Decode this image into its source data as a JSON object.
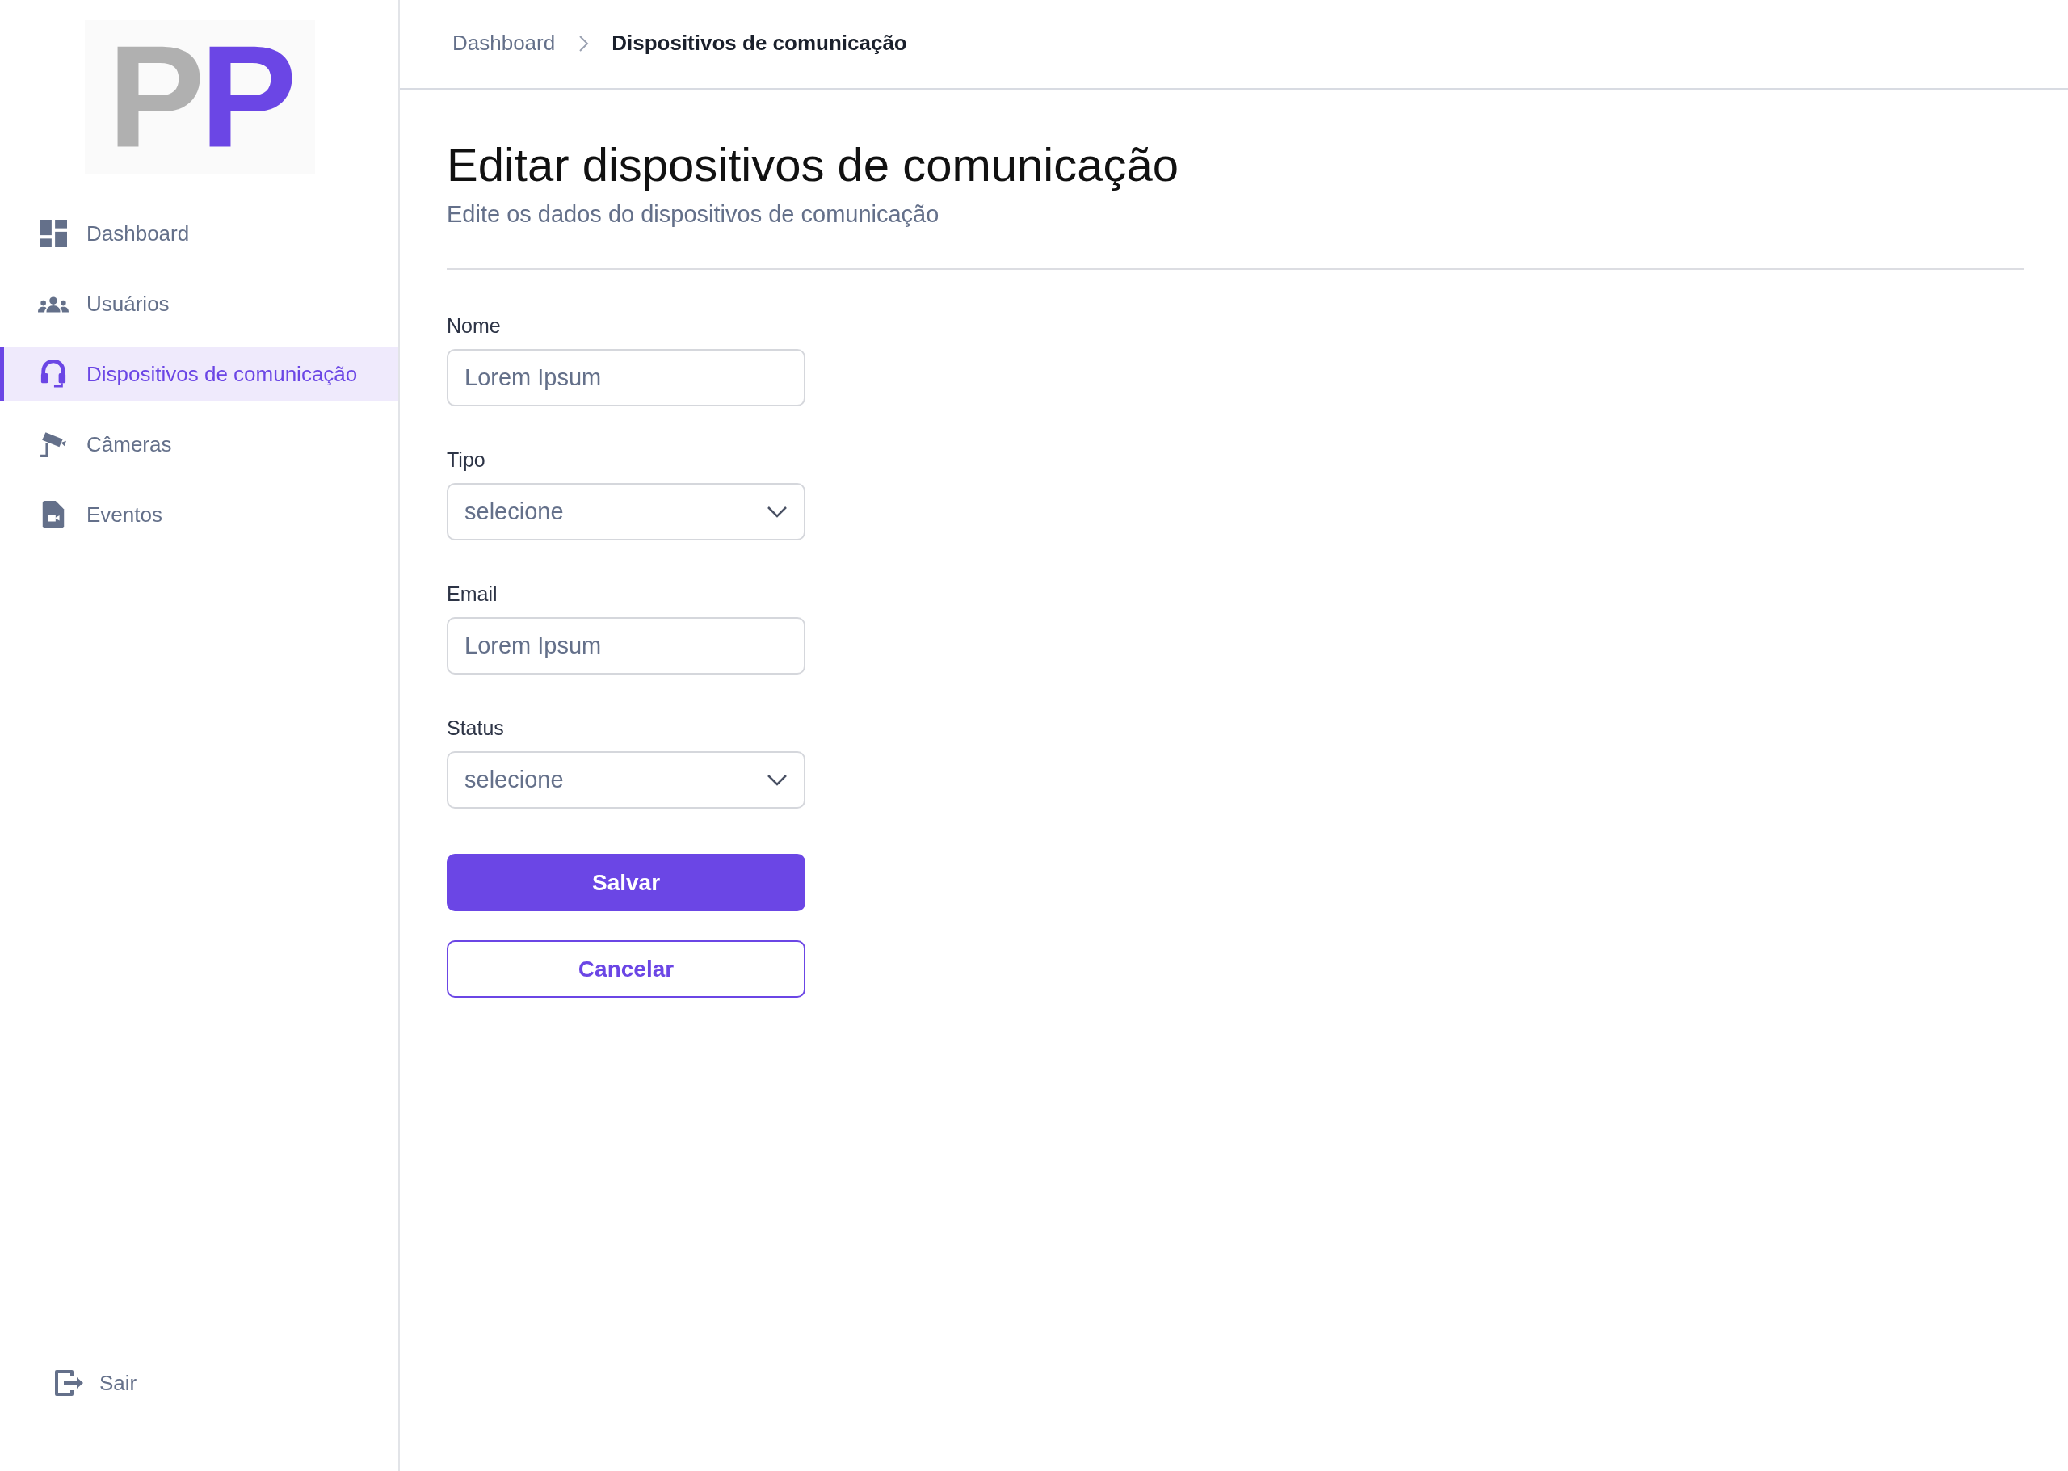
{
  "logo": {
    "text": "PP"
  },
  "sidebar": {
    "items": [
      {
        "label": "Dashboard",
        "selected": false
      },
      {
        "label": "Usuários",
        "selected": false
      },
      {
        "label": "Dispositivos de comunicação",
        "selected": true
      },
      {
        "label": "Câmeras",
        "selected": false
      },
      {
        "label": "Eventos",
        "selected": false
      }
    ],
    "logout": "Sair"
  },
  "breadcrumb": [
    {
      "label": "Dashboard",
      "selected": false
    },
    {
      "label": "Dispositivos de comunicação",
      "selected": true
    }
  ],
  "page": {
    "title": "Editar dispositivos de comunicação",
    "subtitle": "Edite os dados do dispositivos de comunicação"
  },
  "form": {
    "fields": [
      {
        "kind": "text",
        "label": "Nome",
        "placeholder": "Lorem Ipsum"
      },
      {
        "kind": "select",
        "label": "Tipo",
        "value": "selecione"
      },
      {
        "kind": "text",
        "label": "Email",
        "placeholder": "Lorem Ipsum"
      },
      {
        "kind": "select",
        "label": "Status",
        "value": "selecione"
      }
    ],
    "buttons": [
      {
        "kind": "primary",
        "label": "Salvar"
      },
      {
        "kind": "secondary",
        "label": "Cancelar"
      }
    ]
  }
}
